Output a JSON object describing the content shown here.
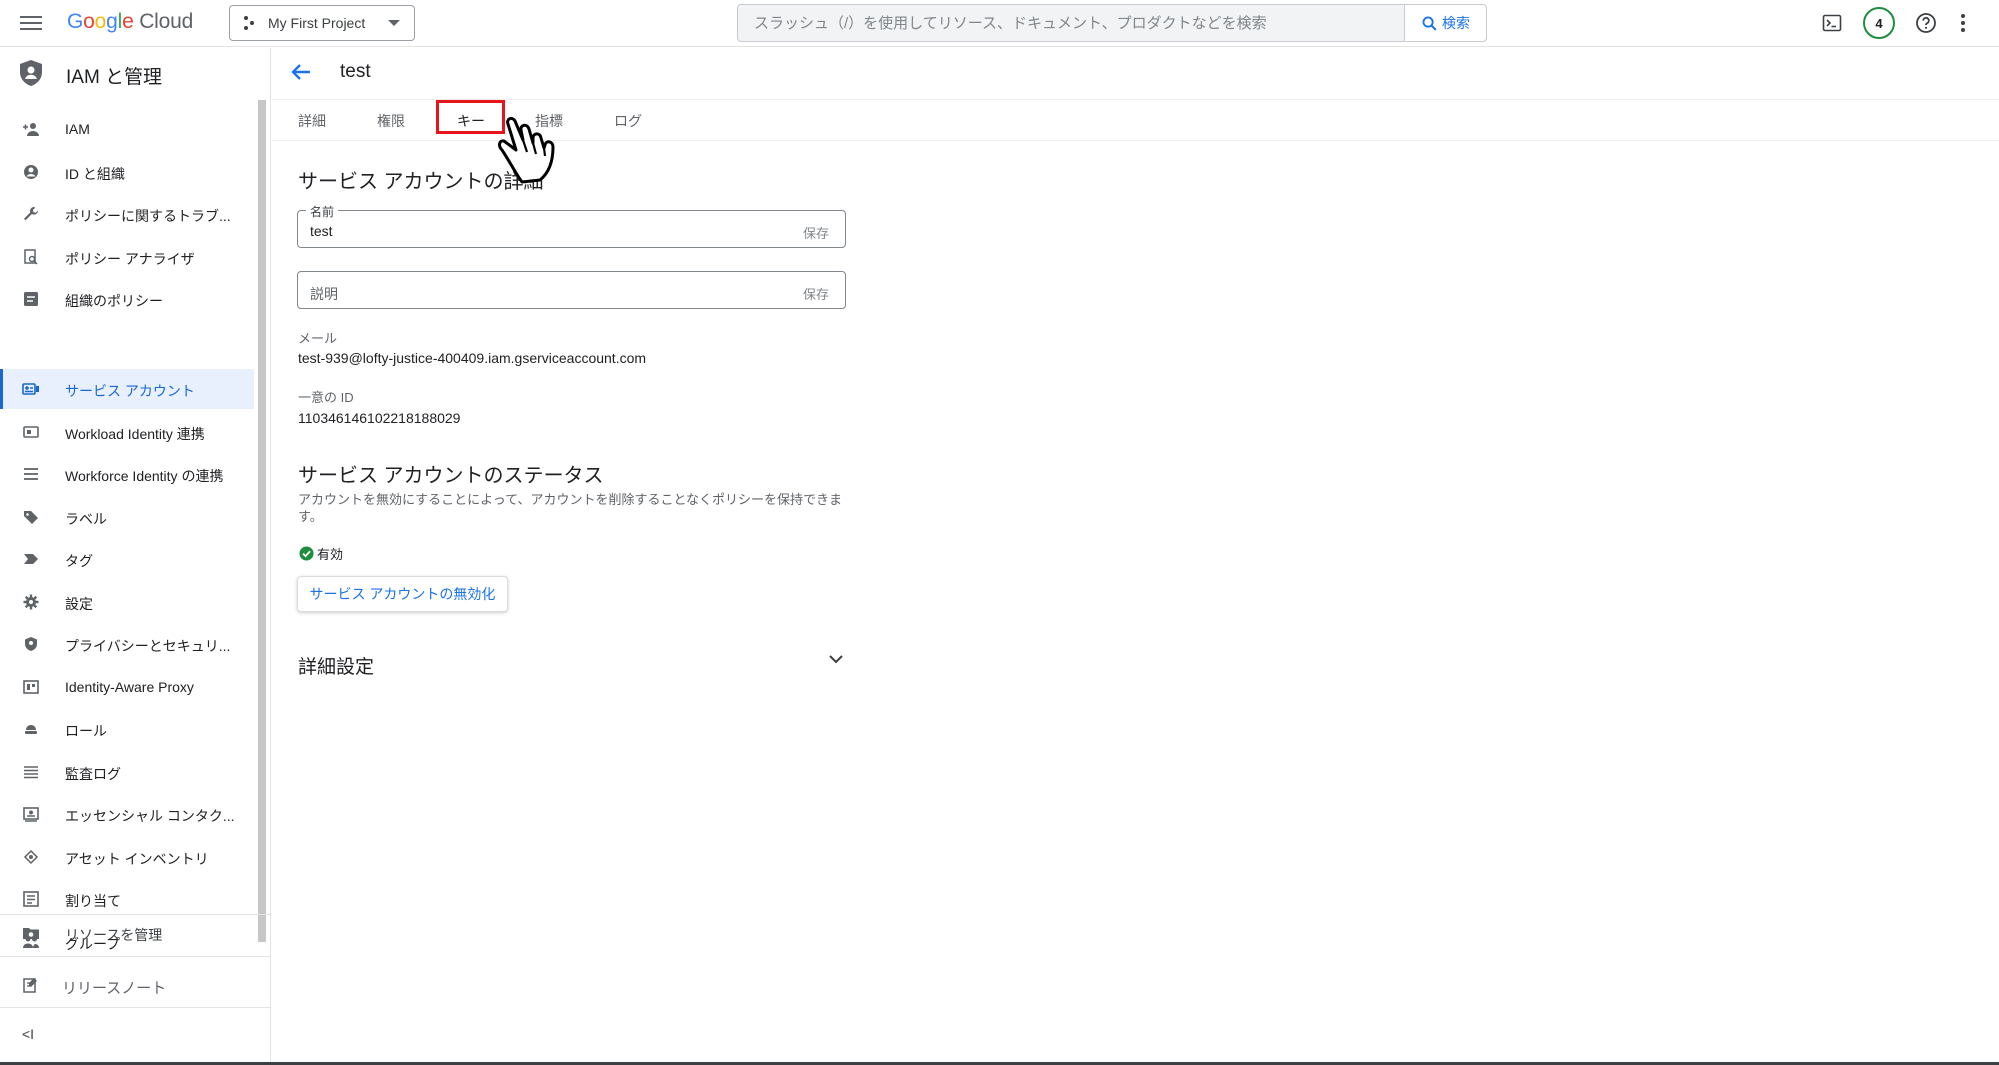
{
  "header": {
    "logo_google": "Google",
    "logo_cloud": "Cloud",
    "project_name": "My First Project",
    "search_placeholder": "スラッシュ（/）を使用してリソース、ドキュメント、プロダクトなどを検索",
    "search_button": "検索",
    "notification_count": "4"
  },
  "sidebar": {
    "title": "IAM と管理",
    "items": [
      {
        "label": "IAM",
        "icon": "person-add-icon"
      },
      {
        "label": "ID と組織",
        "icon": "account-circle-icon"
      },
      {
        "label": "ポリシーに関するトラブ...",
        "icon": "wrench-icon"
      },
      {
        "label": "ポリシー アナライザ",
        "icon": "document-search-icon"
      },
      {
        "label": "組織のポリシー",
        "icon": "list-box-icon"
      },
      {
        "label": "サービス アカウント",
        "icon": "service-account-icon",
        "active": true
      },
      {
        "label": "Workload Identity 連携",
        "icon": "id-card-icon"
      },
      {
        "label": "Workforce Identity の連携",
        "icon": "list-icon"
      },
      {
        "label": "ラベル",
        "icon": "tag-icon"
      },
      {
        "label": "タグ",
        "icon": "arrow-tag-icon"
      },
      {
        "label": "設定",
        "icon": "gear-icon"
      },
      {
        "label": "プライバシーとセキュリ...",
        "icon": "shield-icon"
      },
      {
        "label": "Identity-Aware Proxy",
        "icon": "proxy-icon"
      },
      {
        "label": "ロール",
        "icon": "role-icon"
      },
      {
        "label": "監査ログ",
        "icon": "audit-list-icon"
      },
      {
        "label": "エッセンシャル コンタク...",
        "icon": "contact-card-icon"
      },
      {
        "label": "アセット インベントリ",
        "icon": "inventory-icon"
      },
      {
        "label": "割り当て",
        "icon": "quota-icon"
      },
      {
        "label": "グループ",
        "icon": "group-icon"
      }
    ],
    "manage_resources": "リソースを管理",
    "release_notes": "リリースノート",
    "collapse": "<I"
  },
  "page": {
    "title": "test",
    "tabs": [
      "詳細",
      "権限",
      "キー",
      "指標",
      "ログ"
    ],
    "details_title": "サービス アカウントの詳細",
    "name_label": "名前",
    "name_value": "test",
    "save_label": "保存",
    "description_placeholder": "説明",
    "email_label": "メール",
    "email_value": "test-939@lofty-justice-400409.iam.gserviceaccount.com",
    "unique_id_label": "一意の ID",
    "unique_id_value": "110346146102218188029",
    "status_title": "サービス アカウントのステータス",
    "status_description": "アカウントを無効にすることによって、アカウントを削除することなくポリシーを保持できます。",
    "status_value": "有効",
    "disable_button": "サービス アカウントの無効化",
    "advanced_settings": "詳細設定"
  },
  "colors": {
    "accent": "#1a73e8",
    "active_nav_bg": "#e8f0fe",
    "highlight_box": "#e8141b",
    "status_ok": "#1e8e3e"
  }
}
